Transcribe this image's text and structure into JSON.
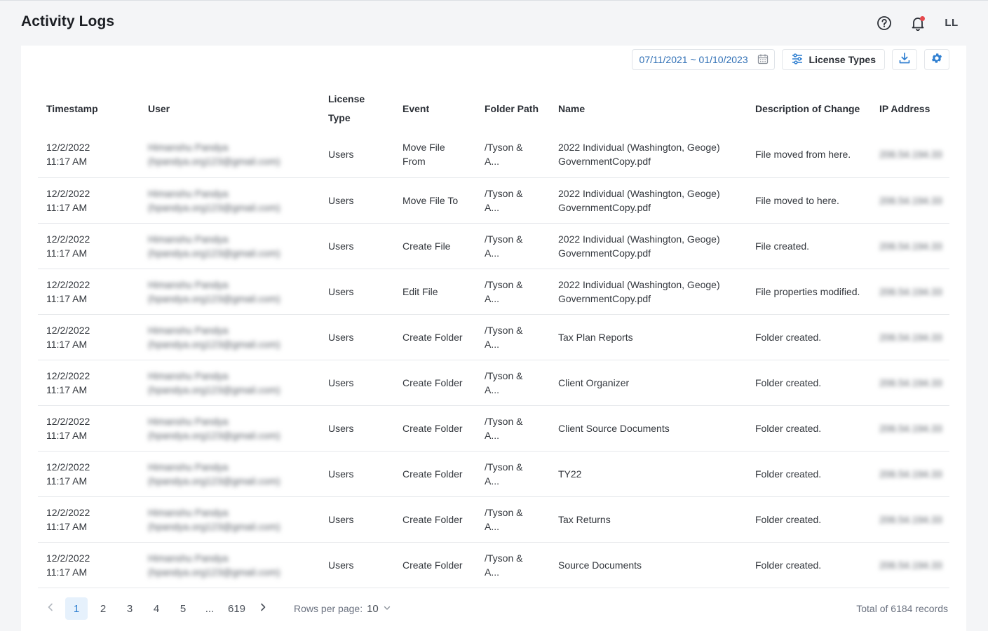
{
  "header": {
    "title": "Activity Logs",
    "avatar_initials": "LL",
    "icons": [
      "help-icon",
      "bell-icon"
    ],
    "notification_dot_color": "#e5484d"
  },
  "toolbar": {
    "date_range": "07/11/2021 ~ 01/10/2023",
    "license_types_label": "License Types",
    "icons": [
      "calendar-icon",
      "sliders-icon",
      "download-icon",
      "gear-icon"
    ],
    "accent_color": "#2f7fd1"
  },
  "table": {
    "columns": [
      "Timestamp",
      "User",
      "License Type",
      "Event",
      "Folder Path",
      "Name",
      "Description of Change",
      "IP Address"
    ],
    "rows": [
      {
        "timestamp": "12/2/2022 11:17 AM",
        "user_name": "Himanshu Pandya",
        "user_email": "(hpandya.org123@gmail.com)",
        "license_type": "Users",
        "event": "Move File From",
        "folder_path": "/Tyson & A...",
        "name": "2022 Individual (Washington, Geoge) GovernmentCopy.pdf",
        "description": "File moved from here.",
        "ip": "206.54.194.33"
      },
      {
        "timestamp": "12/2/2022 11:17 AM",
        "user_name": "Himanshu Pandya",
        "user_email": "(hpandya.org123@gmail.com)",
        "license_type": "Users",
        "event": "Move File To",
        "folder_path": "/Tyson & A...",
        "name": "2022 Individual (Washington, Geoge) GovernmentCopy.pdf",
        "description": "File moved to here.",
        "ip": "206.54.194.33"
      },
      {
        "timestamp": "12/2/2022 11:17 AM",
        "user_name": "Himanshu Pandya",
        "user_email": "(hpandya.org123@gmail.com)",
        "license_type": "Users",
        "event": "Create File",
        "folder_path": "/Tyson & A...",
        "name": "2022 Individual (Washington, Geoge) GovernmentCopy.pdf",
        "description": "File created.",
        "ip": "206.54.194.33"
      },
      {
        "timestamp": "12/2/2022 11:17 AM",
        "user_name": "Himanshu Pandya",
        "user_email": "(hpandya.org123@gmail.com)",
        "license_type": "Users",
        "event": "Edit File",
        "folder_path": "/Tyson & A...",
        "name": "2022 Individual (Washington, Geoge) GovernmentCopy.pdf",
        "description": "File properties modified.",
        "ip": "206.54.194.33"
      },
      {
        "timestamp": "12/2/2022 11:17 AM",
        "user_name": "Himanshu Pandya",
        "user_email": "(hpandya.org123@gmail.com)",
        "license_type": "Users",
        "event": "Create Folder",
        "folder_path": "/Tyson & A...",
        "name": "Tax Plan Reports",
        "description": "Folder created.",
        "ip": "206.54.194.33"
      },
      {
        "timestamp": "12/2/2022 11:17 AM",
        "user_name": "Himanshu Pandya",
        "user_email": "(hpandya.org123@gmail.com)",
        "license_type": "Users",
        "event": "Create Folder",
        "folder_path": "/Tyson & A...",
        "name": "Client Organizer",
        "description": "Folder created.",
        "ip": "206.54.194.33"
      },
      {
        "timestamp": "12/2/2022 11:17 AM",
        "user_name": "Himanshu Pandya",
        "user_email": "(hpandya.org123@gmail.com)",
        "license_type": "Users",
        "event": "Create Folder",
        "folder_path": "/Tyson & A...",
        "name": "Client Source Documents",
        "description": "Folder created.",
        "ip": "206.54.194.33"
      },
      {
        "timestamp": "12/2/2022 11:17 AM",
        "user_name": "Himanshu Pandya",
        "user_email": "(hpandya.org123@gmail.com)",
        "license_type": "Users",
        "event": "Create Folder",
        "folder_path": "/Tyson & A...",
        "name": "TY22",
        "description": "Folder created.",
        "ip": "206.54.194.33"
      },
      {
        "timestamp": "12/2/2022 11:17 AM",
        "user_name": "Himanshu Pandya",
        "user_email": "(hpandya.org123@gmail.com)",
        "license_type": "Users",
        "event": "Create Folder",
        "folder_path": "/Tyson & A...",
        "name": "Tax Returns",
        "description": "Folder created.",
        "ip": "206.54.194.33"
      },
      {
        "timestamp": "12/2/2022 11:17 AM",
        "user_name": "Himanshu Pandya",
        "user_email": "(hpandya.org123@gmail.com)",
        "license_type": "Users",
        "event": "Create Folder",
        "folder_path": "/Tyson & A...",
        "name": "Source Documents",
        "description": "Folder created.",
        "ip": "206.54.194.33"
      }
    ]
  },
  "pagination": {
    "pages": [
      "1",
      "2",
      "3",
      "4",
      "5",
      "...",
      "619"
    ],
    "current_page": "1",
    "rows_per_page_label": "Rows per page:",
    "rows_per_page_value": "10",
    "total_label": "Total of 6184 records"
  }
}
